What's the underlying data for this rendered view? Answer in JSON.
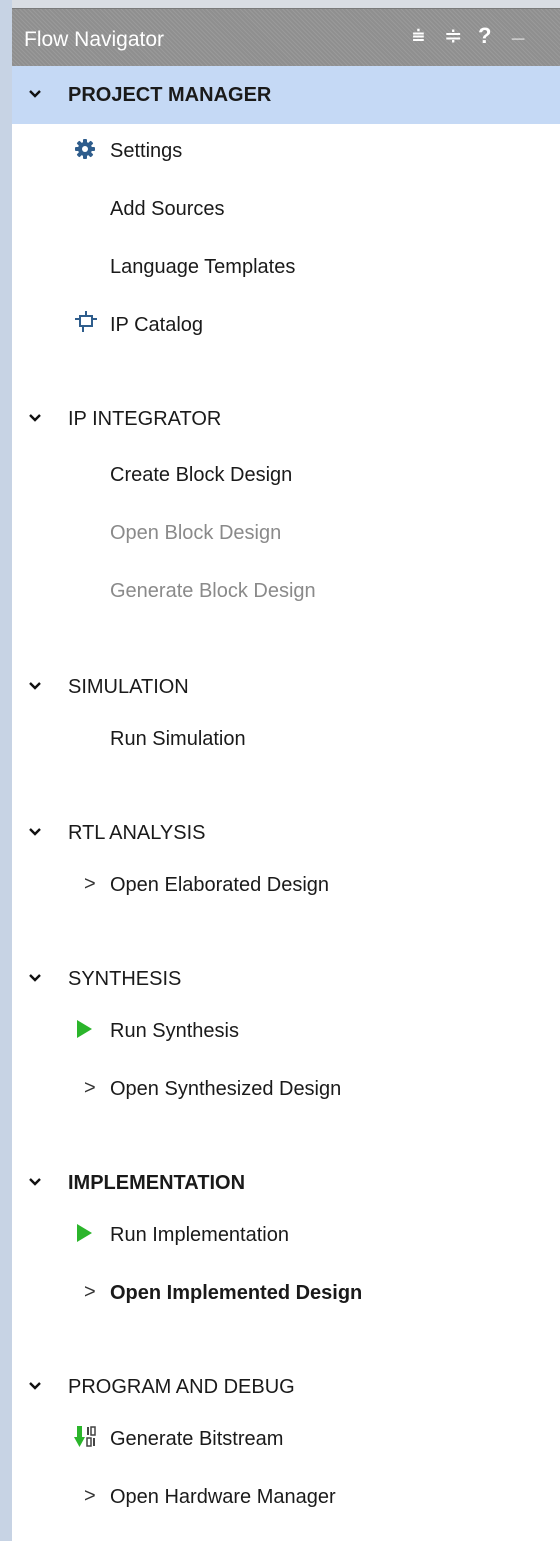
{
  "title": "Flow Navigator",
  "toolbar_icons": [
    "collapse-all-icon",
    "expand-collapse-icon",
    "help-icon",
    "minimize-icon"
  ],
  "toolbar_glyphs": {
    "collapse_all": "⩧",
    "expand_collapse": "≑",
    "help": "?",
    "minimize": "_"
  },
  "colors": {
    "selected": "#c5d9f5",
    "run_green": "#2bb52b",
    "gear_blue": "#2f5d8c",
    "disabled_text": "#8a8a8a"
  },
  "sections": {
    "project_manager": {
      "label": "PROJECT MANAGER",
      "items": {
        "settings": "Settings",
        "add_sources": "Add Sources",
        "language_templates": "Language Templates",
        "ip_catalog": "IP Catalog"
      }
    },
    "ip_integrator": {
      "label": "IP INTEGRATOR",
      "items": {
        "create_block_design": "Create Block Design",
        "open_block_design": "Open Block Design",
        "generate_block_design": "Generate Block Design"
      }
    },
    "simulation": {
      "label": "SIMULATION",
      "items": {
        "run_simulation": "Run Simulation"
      }
    },
    "rtl_analysis": {
      "label": "RTL ANALYSIS",
      "items": {
        "open_elaborated_design": "Open Elaborated Design"
      }
    },
    "synthesis": {
      "label": "SYNTHESIS",
      "items": {
        "run_synthesis": "Run Synthesis",
        "open_synthesized_design": "Open Synthesized Design"
      }
    },
    "implementation": {
      "label": "IMPLEMENTATION",
      "items": {
        "run_implementation": "Run Implementation",
        "open_implemented_design": "Open Implemented Design"
      }
    },
    "program_and_debug": {
      "label": "PROGRAM AND DEBUG",
      "items": {
        "generate_bitstream": "Generate Bitstream",
        "open_hardware_manager": "Open Hardware Manager"
      }
    }
  },
  "sub_chevron": ">"
}
